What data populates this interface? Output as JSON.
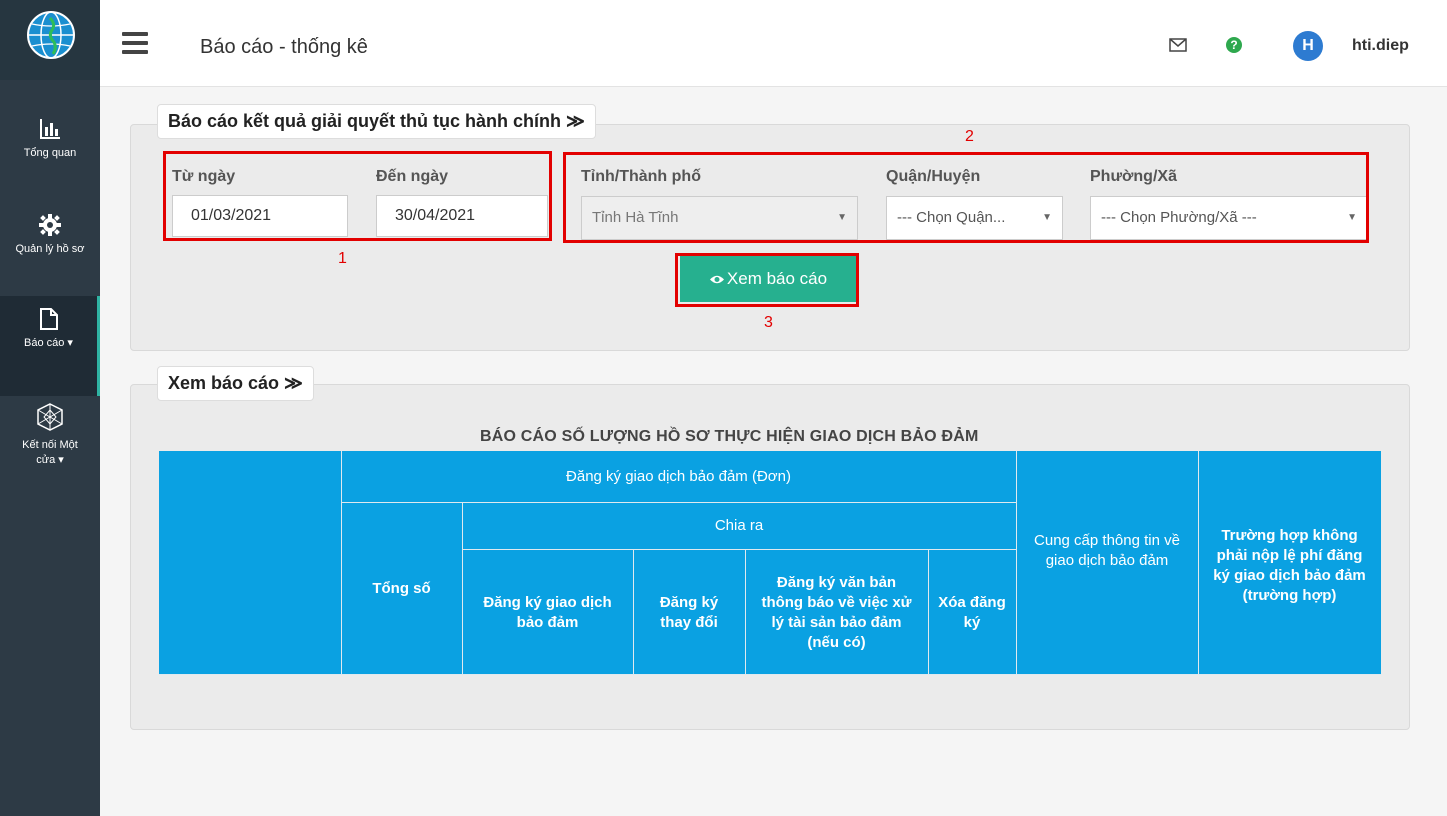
{
  "header": {
    "page_title": "Báo cáo - thống kê",
    "user_initial": "H",
    "username": "hti.diep",
    "help_glyph": "?"
  },
  "sidebar": {
    "items": [
      {
        "label": "Tổng quan",
        "icon": "bar-chart-icon"
      },
      {
        "label": "Quản lý hồ sơ",
        "icon": "gear-icon"
      },
      {
        "label": "Báo cáo ▾",
        "icon": "file-icon"
      },
      {
        "label": "Kết nối Một",
        "label2": "cửa ▾",
        "icon": "network-icon"
      }
    ]
  },
  "filter": {
    "legend": "Báo cáo kết quả giải quyết thủ tục hành chính ≫",
    "from_label": "Từ ngày",
    "from_value": "01/03/2021",
    "to_label": "Đến ngày",
    "to_value": "30/04/2021",
    "province_label": "Tỉnh/Thành phố",
    "province_value": "Tỉnh Hà Tĩnh",
    "district_label": "Quận/Huyện",
    "district_value": "--- Chọn Quận...",
    "ward_label": "Phường/Xã",
    "ward_value": "--- Chọn Phường/Xã ---",
    "view_button": "Xem báo cáo",
    "markers": [
      "1",
      "2",
      "3"
    ]
  },
  "report": {
    "legend": "Xem báo cáo ≫",
    "title": "BÁO CÁO SỐ LƯỢNG HỒ SƠ THỰC HIỆN GIAO DỊCH BẢO ĐẢM",
    "headers": {
      "group_registration": "Đăng ký giao dịch bảo đảm (Đơn)",
      "total": "Tổng số",
      "breakdown": "Chia ra",
      "col_register": "Đăng ký giao dịch bảo đảm",
      "col_change": "Đăng ký thay đổi",
      "col_notice": "Đăng ký văn bản thông báo về việc xử lý tài sản bảo đảm (nếu có)",
      "col_delete": "Xóa đăng ký",
      "col_info": "Cung cấp thông tin về giao dịch bảo đảm",
      "col_nofee": "Trường hợp không phải nộp lệ phí đăng ký giao dịch bảo đảm (trường hợp)"
    }
  },
  "colors": {
    "sidebar": "#2d3a45",
    "table_header": "#0aa1e2",
    "button": "#26b08f",
    "annotation": "#e20000"
  }
}
